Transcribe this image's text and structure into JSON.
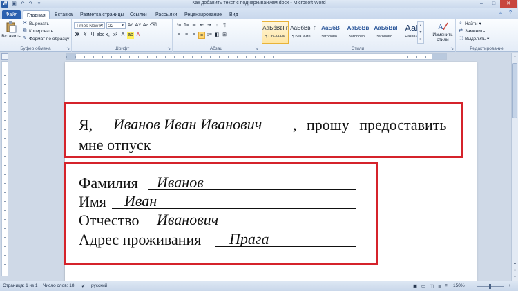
{
  "window": {
    "title": "Как добавить текст с подчеркиванием.docx - Microsoft Word",
    "app_icon": "W"
  },
  "tabs": [
    {
      "label": "Файл"
    },
    {
      "label": "Главная"
    },
    {
      "label": "Вставка"
    },
    {
      "label": "Разметка страницы"
    },
    {
      "label": "Ссылки"
    },
    {
      "label": "Рассылки"
    },
    {
      "label": "Рецензирование"
    },
    {
      "label": "Вид"
    }
  ],
  "ribbon": {
    "clipboard": {
      "paste": "Вставить",
      "cut": "Вырезать",
      "copy": "Копировать",
      "format_painter": "Формат по образцу",
      "label": "Буфер обмена"
    },
    "font": {
      "name": "Times New R",
      "size": "22",
      "label": "Шрифт"
    },
    "paragraph": {
      "label": "Абзац"
    },
    "styles": {
      "items": [
        {
          "preview": "АаБбВвГг",
          "name": "¶ Обычный"
        },
        {
          "preview": "АаБбВвГг",
          "name": "¶ Без инте..."
        },
        {
          "preview": "АаБбВ",
          "name": "Заголово..."
        },
        {
          "preview": "АаБбВв",
          "name": "Заголово..."
        },
        {
          "preview": "АаБбВвI",
          "name": "Заголово..."
        },
        {
          "preview": "АаБ",
          "name": "Название"
        }
      ],
      "change_styles": "Изменить стили",
      "label": "Стили"
    },
    "editing": {
      "find": "Найти",
      "replace": "Заменить",
      "select": "Выделить",
      "label": "Редактирование"
    }
  },
  "document": {
    "box1": {
      "prefix": "Я,",
      "name": "Иванов Иван Иванович",
      "suffix": ", прошу предоставить",
      "line2": "мне отпуск"
    },
    "box2": {
      "rows": [
        {
          "label": "Фамилия",
          "value": "Иванов"
        },
        {
          "label": "Имя",
          "value": "Иван"
        },
        {
          "label": "Отчество",
          "value": "Иванович"
        },
        {
          "label": "Адрес проживания",
          "value": "Прага"
        }
      ]
    }
  },
  "statusbar": {
    "page": "Страница: 1 из 1",
    "words": "Число слов: 18",
    "language": "русский",
    "zoom": "150%"
  },
  "colors": {
    "highlight_border": "#d5232b",
    "file_tab": "#2b61b0"
  }
}
